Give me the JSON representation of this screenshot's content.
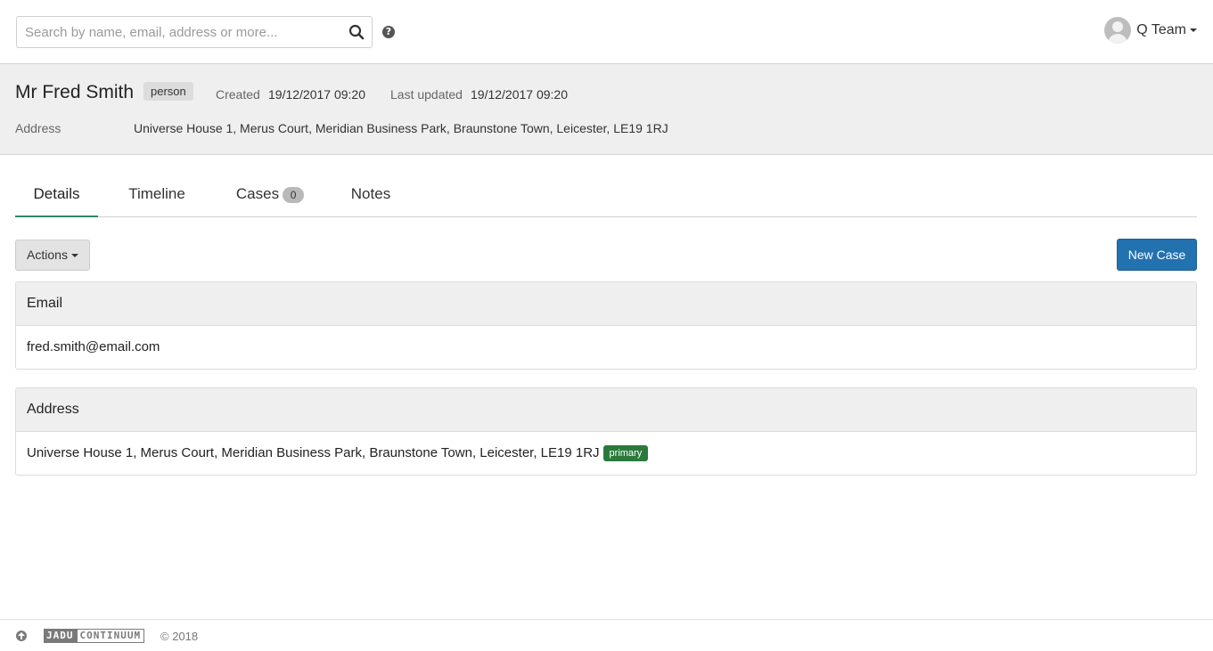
{
  "search": {
    "placeholder": "Search by name, email, address or more..."
  },
  "topbar": {
    "user_name": "Q Team"
  },
  "header": {
    "name": "Mr Fred Smith",
    "type_badge": "person",
    "created_label": "Created",
    "created_value": "19/12/2017 09:20",
    "updated_label": "Last updated",
    "updated_value": "19/12/2017 09:20",
    "address_label": "Address",
    "address_value": "Universe House 1, Merus Court, Meridian Business Park, Braunstone Town, Leicester, LE19 1RJ"
  },
  "tabs": [
    {
      "label": "Details",
      "active": true
    },
    {
      "label": "Timeline"
    },
    {
      "label": "Cases",
      "count": "0"
    },
    {
      "label": "Notes"
    }
  ],
  "actions": {
    "actions_label": "Actions",
    "new_case_label": "New Case"
  },
  "email_panel": {
    "title": "Email",
    "value": "fred.smith@email.com"
  },
  "address_panel": {
    "title": "Address",
    "value": "Universe House 1, Merus Court, Meridian Business Park, Braunstone Town, Leicester, LE19 1RJ",
    "badge": "primary"
  },
  "footer": {
    "logo_part1": "JADU",
    "logo_part2": "CONTINUUM",
    "copyright": "© 2018"
  },
  "colors": {
    "primary_button": "#2372b0",
    "active_tab": "#2a8a6b",
    "primary_badge": "#2b7a3b"
  },
  "icons": {
    "search": "search-icon",
    "help": "help-icon",
    "up": "up-arrow-icon"
  }
}
